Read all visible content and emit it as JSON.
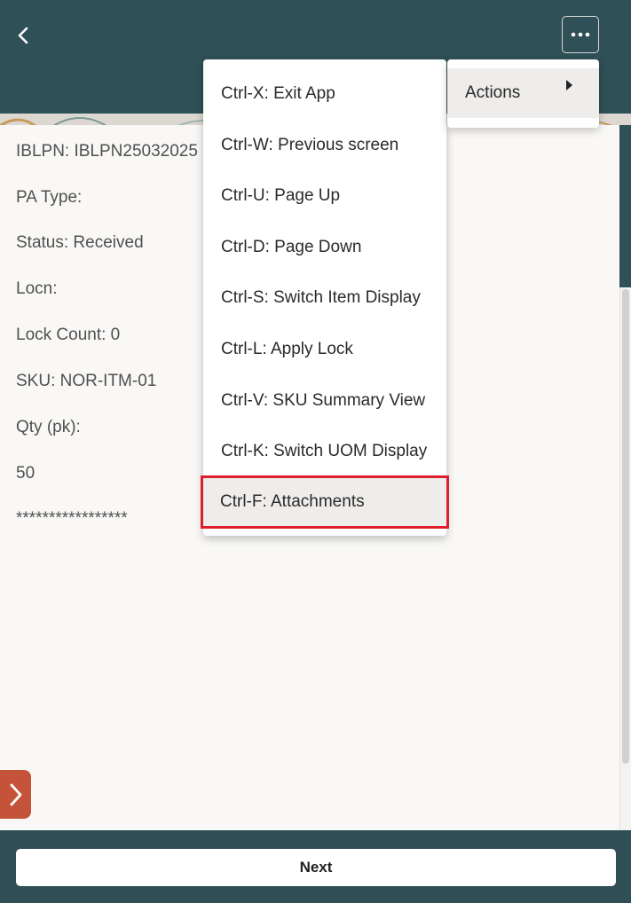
{
  "header": {
    "back_icon": "chevron-left-icon",
    "more_icon": "ellipsis-icon"
  },
  "fields": [
    {
      "name": "iblpn",
      "text": "IBLPN: IBLPN25032025"
    },
    {
      "name": "pa-type",
      "text": "PA Type:"
    },
    {
      "name": "status",
      "text": "Status: Received"
    },
    {
      "name": "locn",
      "text": "Locn:"
    },
    {
      "name": "lock-count",
      "text": "Lock Count: 0"
    },
    {
      "name": "sku",
      "text": "SKU: NOR-ITM-01"
    },
    {
      "name": "qty-label",
      "text": "Qty (pk):"
    },
    {
      "name": "qty-value",
      "text": "50"
    },
    {
      "name": "masked",
      "text": "*****************"
    }
  ],
  "menu": {
    "actions_label": "Actions",
    "items": [
      {
        "label": "Ctrl-X: Exit App"
      },
      {
        "label": "Ctrl-W: Previous screen"
      },
      {
        "label": "Ctrl-U: Page Up"
      },
      {
        "label": "Ctrl-D: Page Down"
      },
      {
        "label": "Ctrl-S: Switch Item Display"
      },
      {
        "label": "Ctrl-L: Apply Lock"
      },
      {
        "label": "Ctrl-V: SKU Summary View"
      },
      {
        "label": "Ctrl-K: Switch UOM Display"
      },
      {
        "label": "Ctrl-F: Attachments",
        "highlighted": true
      }
    ]
  },
  "footer": {
    "next_label": "Next"
  },
  "colors": {
    "header_bg": "#2f5056",
    "side_tab": "#c4533a",
    "highlight_border": "#e01e2b"
  }
}
